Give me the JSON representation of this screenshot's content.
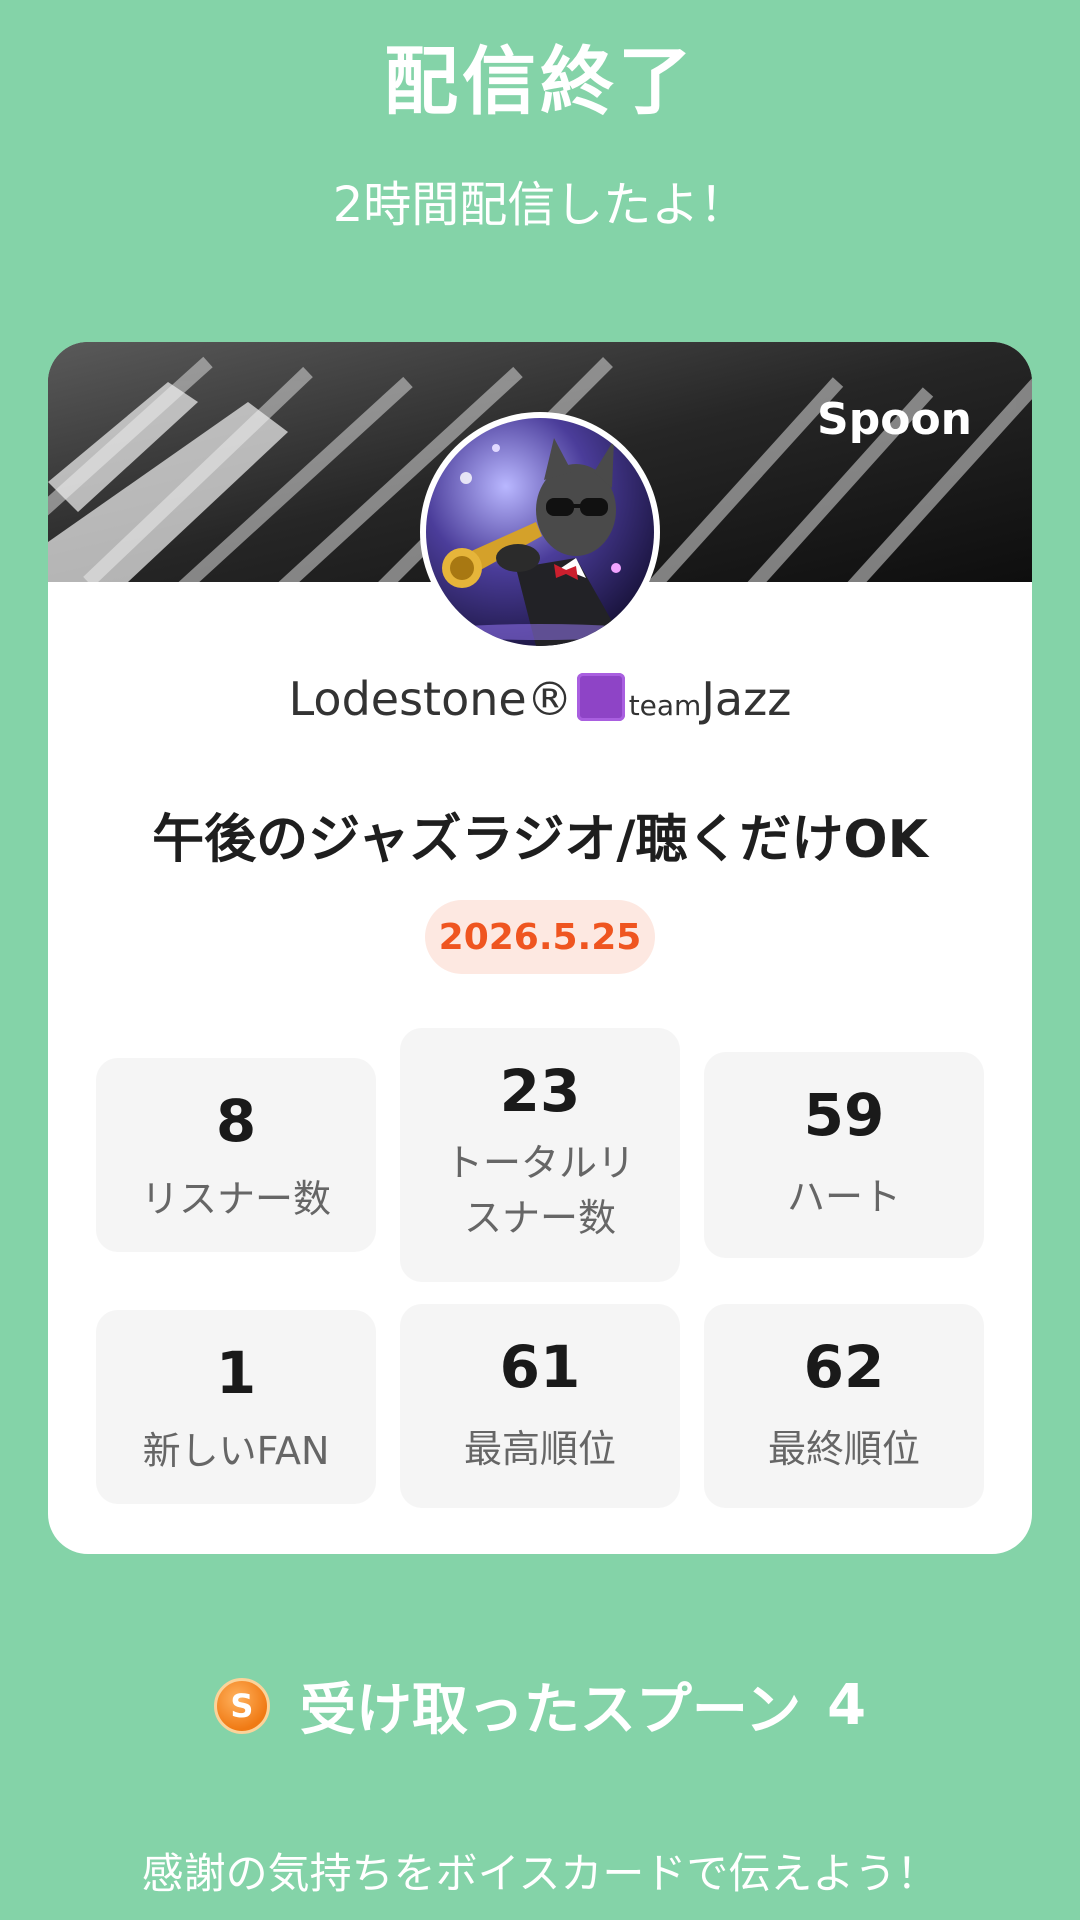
{
  "header": {
    "title": "配信終了",
    "subtitle": "2時間配信したよ！"
  },
  "card": {
    "brand": "Spoon",
    "username_main": "Lodestone®",
    "username_small": "team",
    "username_tail": "Jazz",
    "stream_title": "午後のジャズラジオ/聴くだけOK",
    "date": "2026.5.25",
    "stats": [
      {
        "value": "8",
        "label": "リスナー数"
      },
      {
        "value": "23",
        "label": "トータルリスナー数"
      },
      {
        "value": "59",
        "label": "ハート"
      },
      {
        "value": "1",
        "label": "新しいFAN"
      },
      {
        "value": "61",
        "label": "最高順位"
      },
      {
        "value": "62",
        "label": "最終順位"
      }
    ]
  },
  "spoons": {
    "coin_letter": "S",
    "label": "受け取ったスプーン",
    "count": "4"
  },
  "footer": {
    "thanks": "感謝の気持ちをボイスカードで伝えよう！"
  },
  "colors": {
    "background": "#84d3a8",
    "date_accent": "#ef5520",
    "coin": "#f07a14"
  }
}
